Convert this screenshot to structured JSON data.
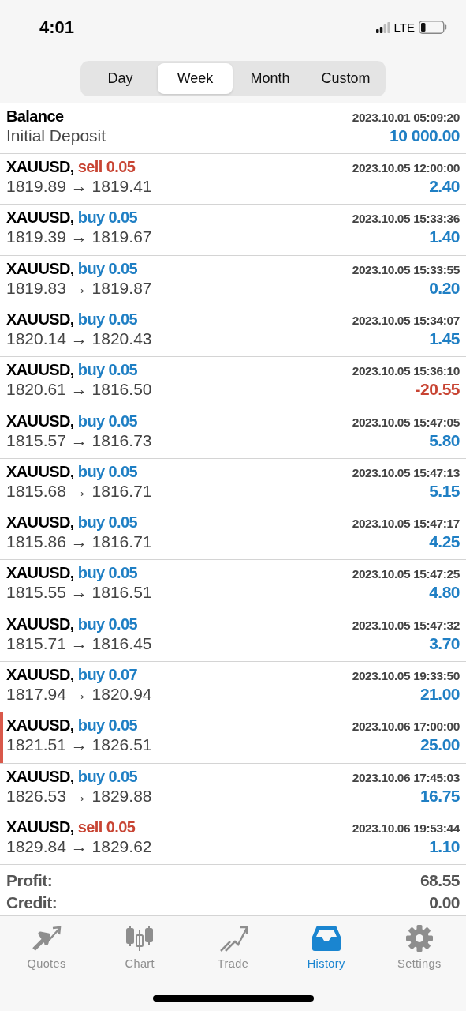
{
  "status_bar": {
    "time": "4:01",
    "network": "LTE"
  },
  "periods": [
    {
      "label": "Day",
      "selected": false
    },
    {
      "label": "Week",
      "selected": true
    },
    {
      "label": "Month",
      "selected": false
    },
    {
      "label": "Custom",
      "selected": false
    }
  ],
  "balance": {
    "title": "Balance",
    "time": "2023.10.01 05:09:20",
    "note": "Initial Deposit",
    "amount": "10 000.00"
  },
  "deals": [
    {
      "symbol": "XAUUSD,",
      "action": "sell 0.05",
      "kind": "sell",
      "time": "2023.10.05 12:00:00",
      "prices": "1819.89 → 1819.41",
      "profit": "2.40",
      "loss": false,
      "selected": false
    },
    {
      "symbol": "XAUUSD,",
      "action": "buy 0.05",
      "kind": "buy",
      "time": "2023.10.05 15:33:36",
      "prices": "1819.39 → 1819.67",
      "profit": "1.40",
      "loss": false,
      "selected": false
    },
    {
      "symbol": "XAUUSD,",
      "action": "buy 0.05",
      "kind": "buy",
      "time": "2023.10.05 15:33:55",
      "prices": "1819.83 → 1819.87",
      "profit": "0.20",
      "loss": false,
      "selected": false
    },
    {
      "symbol": "XAUUSD,",
      "action": "buy 0.05",
      "kind": "buy",
      "time": "2023.10.05 15:34:07",
      "prices": "1820.14 → 1820.43",
      "profit": "1.45",
      "loss": false,
      "selected": false
    },
    {
      "symbol": "XAUUSD,",
      "action": "buy 0.05",
      "kind": "buy",
      "time": "2023.10.05 15:36:10",
      "prices": "1820.61 → 1816.50",
      "profit": "-20.55",
      "loss": true,
      "selected": false
    },
    {
      "symbol": "XAUUSD,",
      "action": "buy 0.05",
      "kind": "buy",
      "time": "2023.10.05 15:47:05",
      "prices": "1815.57 → 1816.73",
      "profit": "5.80",
      "loss": false,
      "selected": false
    },
    {
      "symbol": "XAUUSD,",
      "action": "buy 0.05",
      "kind": "buy",
      "time": "2023.10.05 15:47:13",
      "prices": "1815.68 → 1816.71",
      "profit": "5.15",
      "loss": false,
      "selected": false
    },
    {
      "symbol": "XAUUSD,",
      "action": "buy 0.05",
      "kind": "buy",
      "time": "2023.10.05 15:47:17",
      "prices": "1815.86 → 1816.71",
      "profit": "4.25",
      "loss": false,
      "selected": false
    },
    {
      "symbol": "XAUUSD,",
      "action": "buy 0.05",
      "kind": "buy",
      "time": "2023.10.05 15:47:25",
      "prices": "1815.55 → 1816.51",
      "profit": "4.80",
      "loss": false,
      "selected": false
    },
    {
      "symbol": "XAUUSD,",
      "action": "buy 0.05",
      "kind": "buy",
      "time": "2023.10.05 15:47:32",
      "prices": "1815.71 → 1816.45",
      "profit": "3.70",
      "loss": false,
      "selected": false
    },
    {
      "symbol": "XAUUSD,",
      "action": "buy 0.07",
      "kind": "buy",
      "time": "2023.10.05 19:33:50",
      "prices": "1817.94 → 1820.94",
      "profit": "21.00",
      "loss": false,
      "selected": false
    },
    {
      "symbol": "XAUUSD,",
      "action": "buy 0.05",
      "kind": "buy",
      "time": "2023.10.06 17:00:00",
      "prices": "1821.51 → 1826.51",
      "profit": "25.00",
      "loss": false,
      "selected": true
    },
    {
      "symbol": "XAUUSD,",
      "action": "buy 0.05",
      "kind": "buy",
      "time": "2023.10.06 17:45:03",
      "prices": "1826.53 → 1829.88",
      "profit": "16.75",
      "loss": false,
      "selected": false
    },
    {
      "symbol": "XAUUSD,",
      "action": "sell 0.05",
      "kind": "sell",
      "time": "2023.10.06 19:53:44",
      "prices": "1829.84 → 1829.62",
      "profit": "1.10",
      "loss": false,
      "selected": false
    }
  ],
  "summary": [
    {
      "label": "Profit:",
      "value": "68.55"
    },
    {
      "label": "Credit:",
      "value": "0.00"
    }
  ],
  "tabs": [
    {
      "label": "Quotes",
      "kind": "quotes",
      "selected": false
    },
    {
      "label": "Chart",
      "kind": "chart",
      "selected": false
    },
    {
      "label": "Trade",
      "kind": "trade",
      "selected": false
    },
    {
      "label": "History",
      "kind": "history",
      "selected": true
    },
    {
      "label": "Settings",
      "kind": "settings",
      "selected": false
    }
  ]
}
